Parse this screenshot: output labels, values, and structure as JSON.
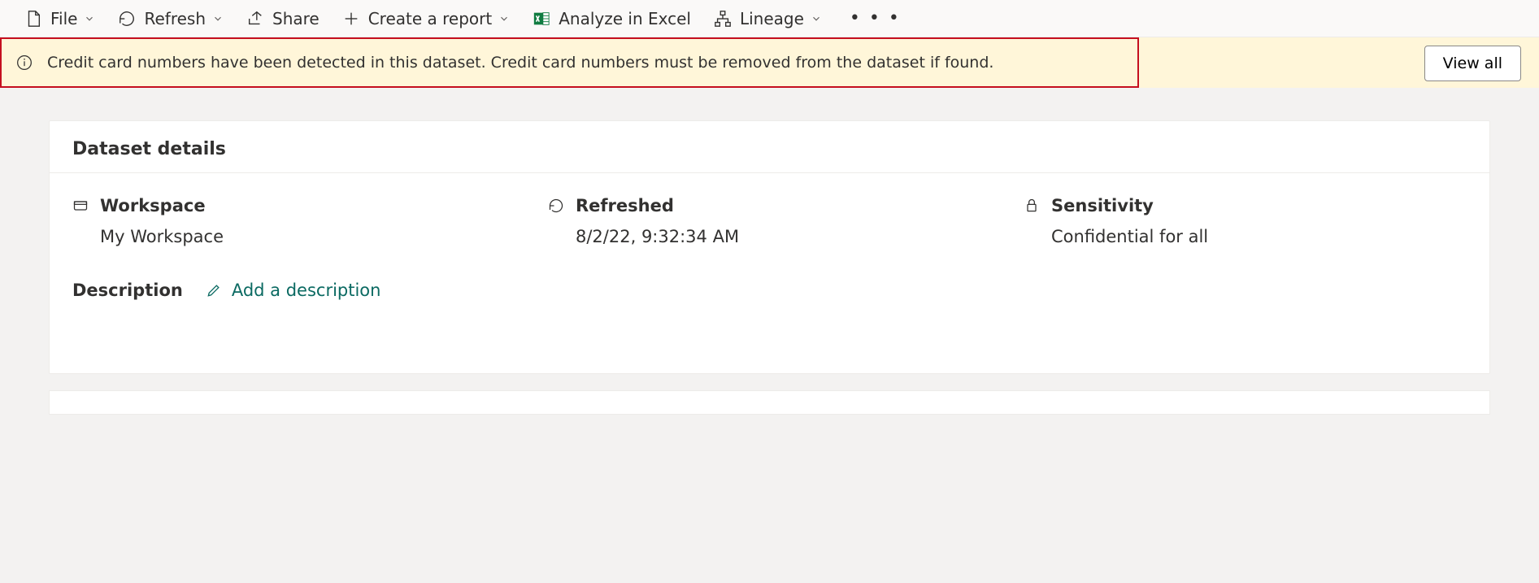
{
  "toolbar": {
    "file": "File",
    "refresh": "Refresh",
    "share": "Share",
    "create_report": "Create a report",
    "analyze_excel": "Analyze in Excel",
    "lineage": "Lineage"
  },
  "banner": {
    "message": "Credit card numbers have been detected in this dataset. Credit card numbers must be removed from the dataset if found.",
    "view_all": "View all"
  },
  "details": {
    "title": "Dataset details",
    "workspace_label": "Workspace",
    "workspace_value": "My Workspace",
    "refreshed_label": "Refreshed",
    "refreshed_value": "8/2/22, 9:32:34 AM",
    "sensitivity_label": "Sensitivity",
    "sensitivity_value": "Confidential for all",
    "description_label": "Description",
    "description_action": "Add a description"
  }
}
